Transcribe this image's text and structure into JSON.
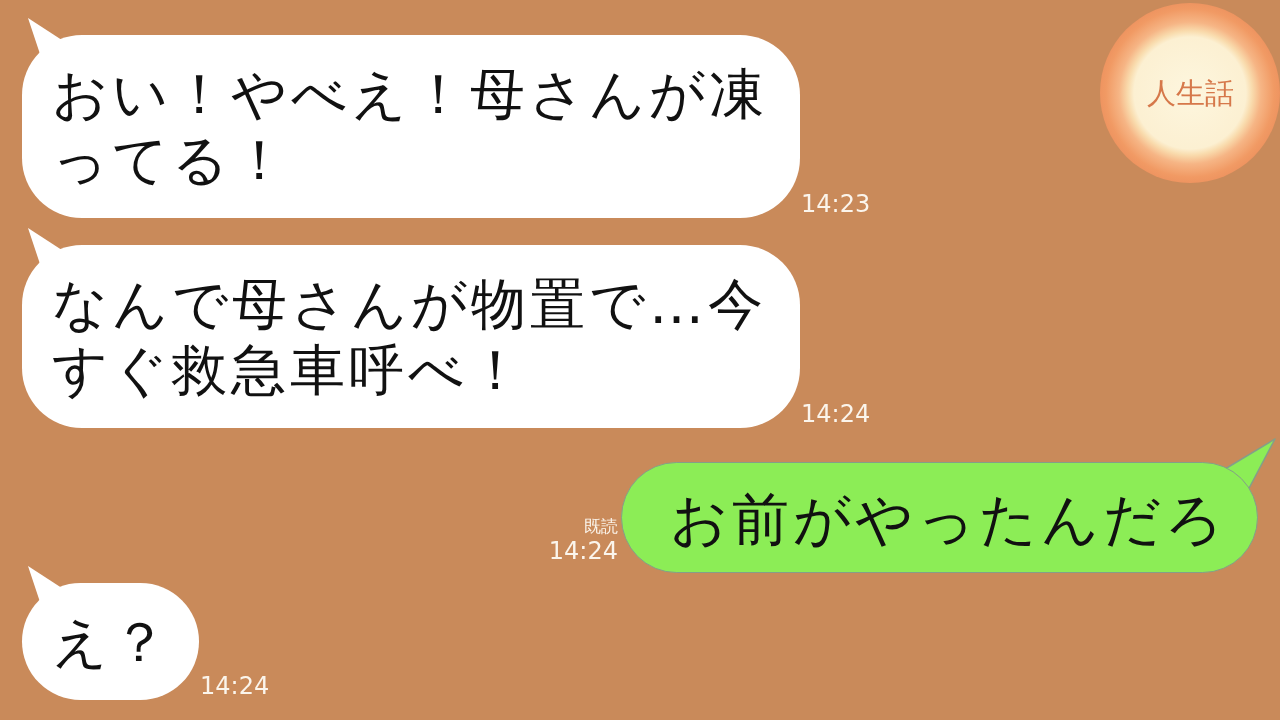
{
  "logo": {
    "text": "人生話"
  },
  "messages": [
    {
      "kind": "received",
      "text": "おい！やべえ！母さんが凍ってる！",
      "time": "14:23"
    },
    {
      "kind": "received",
      "text": "なんで母さんが物置で…今すぐ救急車呼べ！",
      "time": "14:24"
    },
    {
      "kind": "sent",
      "text": "お前がやったんだろ",
      "read_receipt": "既読",
      "time": "14:24"
    },
    {
      "kind": "received",
      "text": "え？",
      "time": "14:24"
    }
  ]
}
